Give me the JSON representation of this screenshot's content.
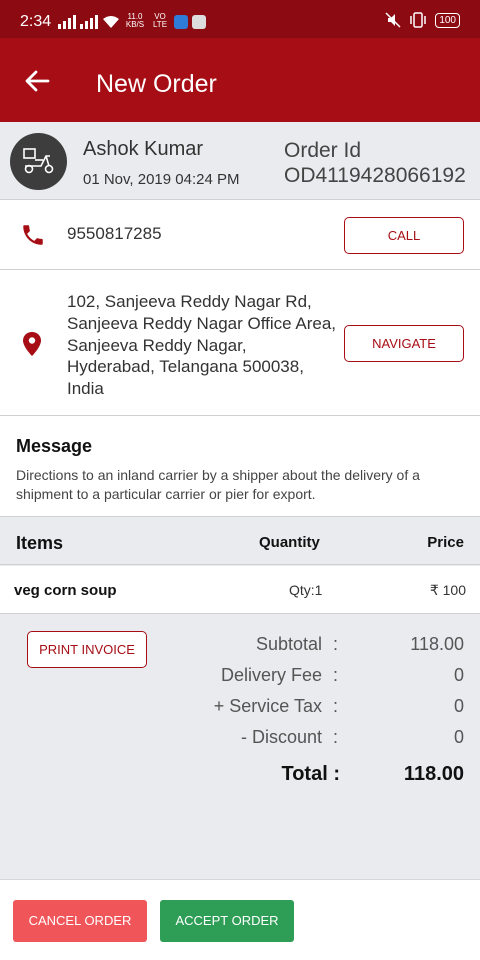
{
  "statusbar": {
    "time": "2:34",
    "net_speed": "11.0 KB/S",
    "volte": "VO LTE",
    "battery": "100"
  },
  "appbar": {
    "title": "New Order"
  },
  "customer": {
    "name": "Ashok Kumar",
    "datetime": "01 Nov, 2019 04:24 PM",
    "order_id_label": "Order Id",
    "order_id": "OD4119428066192"
  },
  "contact": {
    "phone": "9550817285",
    "call_label": "CALL"
  },
  "address": {
    "text": "102, Sanjeeva Reddy Nagar Rd, Sanjeeva Reddy Nagar Office Area, Sanjeeva Reddy Nagar, Hyderabad, Telangana 500038, India",
    "navigate_label": "NAVIGATE"
  },
  "message": {
    "title": "Message",
    "body": "Directions to an inland carrier by a shipper about the delivery of a shipment to a particular carrier or pier for export."
  },
  "items_header": {
    "items": "Items",
    "quantity": "Quantity",
    "price": "Price"
  },
  "items": [
    {
      "name": "veg corn soup",
      "qty": "Qty:1",
      "price": "₹ 100"
    }
  ],
  "summary": {
    "print_label": "PRINT INVOICE",
    "colon": ":",
    "subtotal_label": "Subtotal",
    "subtotal": "118.00",
    "delivery_label": "Delivery Fee",
    "delivery": "0",
    "tax_label": "+ Service Tax",
    "tax": "0",
    "discount_label": "- Discount",
    "discount": "0",
    "total_label": "Total :",
    "total": "118.00"
  },
  "actions": {
    "cancel": "CANCEL ORDER",
    "accept": "ACCEPT ORDER"
  },
  "colors": {
    "primary": "#a60d14",
    "status": "#8c0b12",
    "cancel": "#f0555a",
    "accept": "#2e9e57"
  }
}
